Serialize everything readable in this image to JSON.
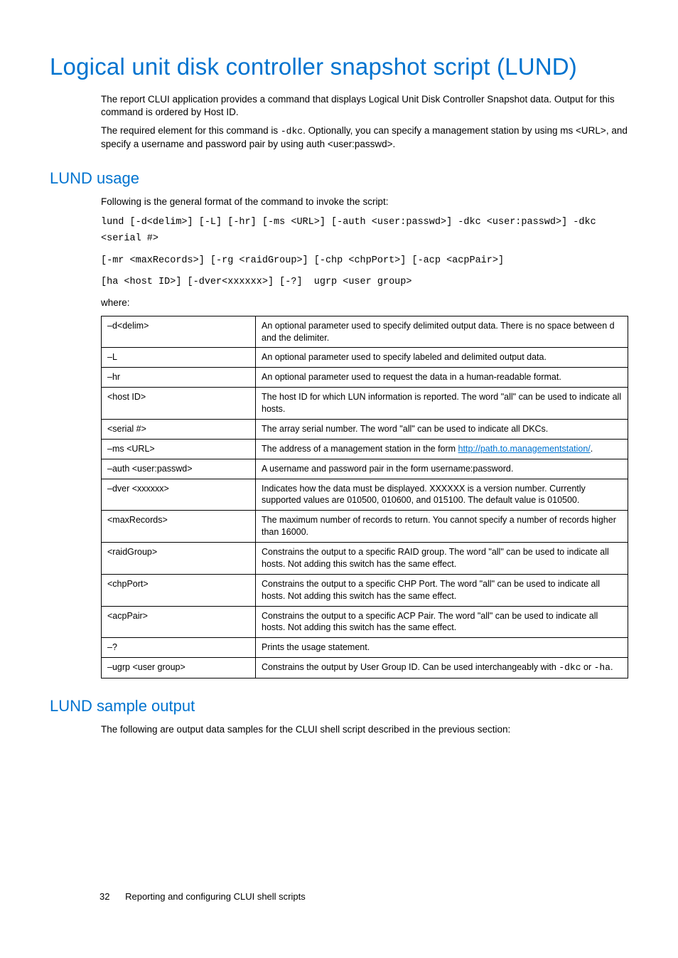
{
  "h1": "Logical unit disk controller snapshot script (LUND)",
  "intro_p1a": "The report CLUI application provides a command that displays Logical Unit Disk Controller Snapshot data. Output for this command is ordered by Host ID.",
  "intro_p2_pre": "The required element for this command is ",
  "intro_p2_code": "-dkc",
  "intro_p2_post": ". Optionally, you can specify a management station by using ms <URL>, and specify a username and password pair by using auth <user:passwd>.",
  "h2_usage": "LUND usage",
  "usage_p": "Following is the general format of the command to invoke the script:",
  "code1": "lund [-d<delim>] [-L] [-hr] [-ms <URL>] [-auth <user:passwd>] -dkc <user:passwd>] -dkc <serial #>",
  "code2": "[-mr <maxRecords>] [-rg <raidGroup>] [-chp <chpPort>] [-acp <acpPair>]",
  "code3": "[ha <host ID>] [-dver<xxxxxx>] [-?]  ugrp <user group>",
  "where": "where:",
  "rows": {
    "ddelim": {
      "k": "–d<delim>",
      "v": "An optional parameter used to specify delimited output data. There is no space between d and the delimiter."
    },
    "l": {
      "k": "–L",
      "v": "An optional parameter used to specify labeled and delimited output data."
    },
    "hr": {
      "k": "–hr",
      "v": "An optional parameter used to request the data in a human-readable format."
    },
    "hostid": {
      "k": "<host ID>",
      "v": "The host ID for which LUN information is reported. The word \"all\" can be used to indicate all hosts."
    },
    "serial": {
      "k": "<serial #>",
      "v": "The array serial number. The word \"all\" can be used to indicate all DKCs."
    },
    "msurl": {
      "k": "–ms <URL>",
      "v_pre": "The address of a management station in the form ",
      "link": "http://path.to.managementstation/",
      "v_post": "."
    },
    "auth": {
      "k": "–auth <user:passwd>",
      "v": "A username and password pair in the form username:password."
    },
    "dver": {
      "k": "–dver <xxxxxx>",
      "v": "Indicates how the data must be displayed. XXXXXX is a version number. Currently supported values are 010500, 010600, and 015100. The default value is 010500."
    },
    "maxrec": {
      "k": "<maxRecords>",
      "v": "The maximum number of records to return. You cannot specify a number of records higher than 16000."
    },
    "raid": {
      "k": "<raidGroup>",
      "v": "Constrains the output to a specific RAID group. The word \"all\" can be used to indicate all hosts. Not adding this switch has the same effect."
    },
    "chp": {
      "k": "<chpPort>",
      "v": "Constrains the output to a specific CHP Port. The word \"all\" can be used to indicate all hosts. Not adding this switch has the same effect."
    },
    "acp": {
      "k": "<acpPair>",
      "v": "Constrains the output to a specific ACP Pair. The word \"all\" can be used to indicate all hosts. Not adding this switch has the same effect."
    },
    "q": {
      "k": "–?",
      "v": "Prints the usage statement."
    },
    "ugrp": {
      "k": "–ugrp <user group>",
      "v_pre": "Constrains the output by User Group ID. Can be used interchangeably with ",
      "c1": "-dkc",
      "mid": " or ",
      "c2": "-ha",
      "v_post": "."
    }
  },
  "h2_sample": "LUND sample output",
  "sample_p": "The following are output data samples for the CLUI shell script described in the previous section:",
  "footer_page": "32",
  "footer_text": "Reporting and configuring CLUI shell scripts"
}
